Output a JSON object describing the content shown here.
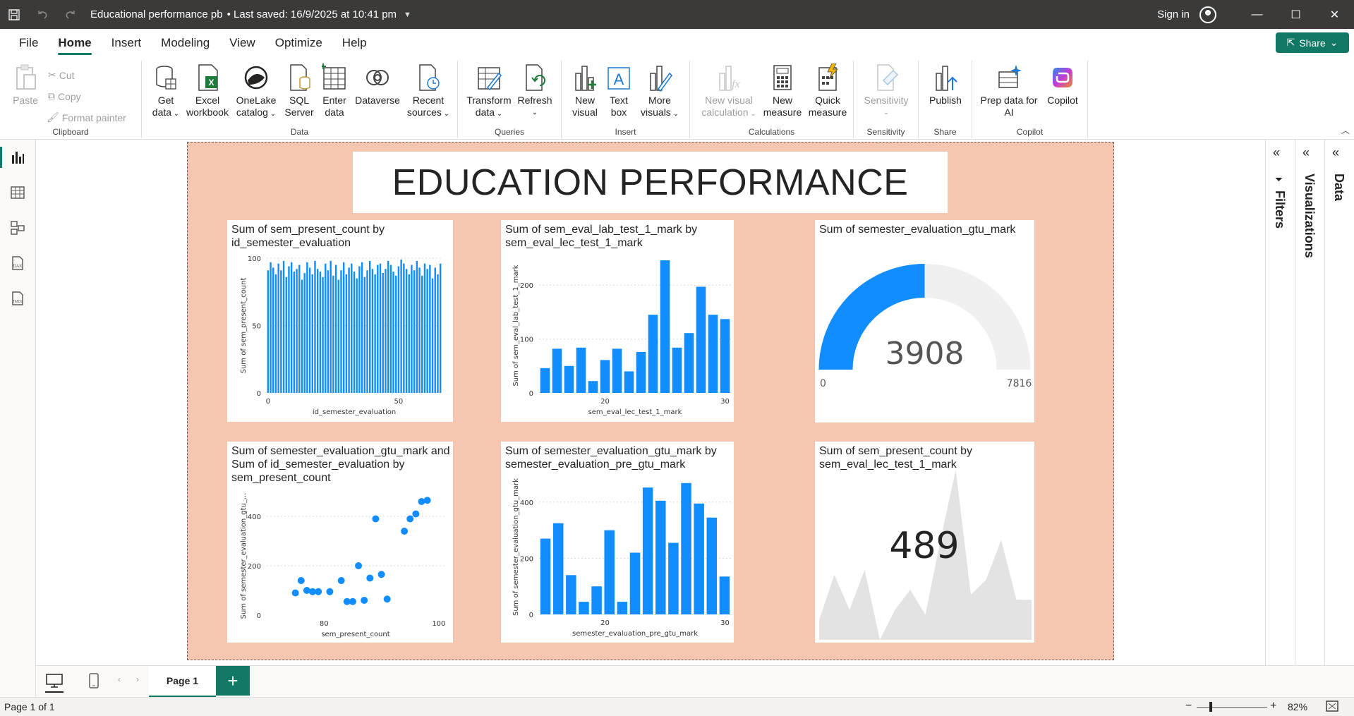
{
  "titlebar": {
    "title": "Educational performance pb",
    "saved": "• Last saved: 16/9/2025 at 10:41 pm",
    "signin": "Sign in"
  },
  "menu": {
    "items": [
      "File",
      "Home",
      "Insert",
      "Modeling",
      "View",
      "Optimize",
      "Help"
    ],
    "active": "Home",
    "share": "Share"
  },
  "ribbon": {
    "clipboard": {
      "label": "Clipboard",
      "paste": "Paste",
      "cut": "Cut",
      "copy": "Copy",
      "format_painter": "Format painter"
    },
    "data": {
      "label": "Data",
      "get_data": [
        "Get",
        "data"
      ],
      "excel": [
        "Excel",
        "workbook"
      ],
      "onelake": [
        "OneLake",
        "catalog"
      ],
      "sql": [
        "SQL",
        "Server"
      ],
      "enter": [
        "Enter",
        "data"
      ],
      "dataverse": [
        "Dataverse",
        ""
      ],
      "recent": [
        "Recent",
        "sources"
      ]
    },
    "queries": {
      "label": "Queries",
      "transform": [
        "Transform",
        "data"
      ],
      "refresh": [
        "Refresh",
        ""
      ]
    },
    "insert": {
      "label": "Insert",
      "new_visual": [
        "New",
        "visual"
      ],
      "text_box": [
        "Text",
        "box"
      ],
      "more_visuals": [
        "More",
        "visuals"
      ]
    },
    "calculations": {
      "label": "Calculations",
      "new_visual_calc": [
        "New visual",
        "calculation"
      ],
      "new_measure": [
        "New",
        "measure"
      ],
      "quick_measure": [
        "Quick",
        "measure"
      ]
    },
    "sensitivity": {
      "label": "Sensitivity",
      "btn": [
        "Sensitivity",
        ""
      ]
    },
    "share": {
      "label": "Share",
      "publish": [
        "Publish",
        ""
      ]
    },
    "copilot": {
      "label": "Copilot",
      "prep": [
        "Prep data for",
        "AI"
      ],
      "copilot": [
        "Copilot",
        ""
      ]
    }
  },
  "report": {
    "title": "EDUCATION PERFORMANCE"
  },
  "visuals": {
    "v1": {
      "title": "Sum of sem_present_count by id_semester_evaluation",
      "xlabel": "id_semester_evaluation",
      "ylabel": "Sum of sem_present_count"
    },
    "v2": {
      "title": "Sum of sem_eval_lab_test_1_mark by sem_eval_lec_test_1_mark",
      "xlabel": "sem_eval_lec_test_1_mark",
      "ylabel": "Sum of sem_eval_lab_test_1_mark"
    },
    "v3": {
      "title": "Sum of semester_evaluation_gtu_mark",
      "value": "3908",
      "min": "0",
      "max": "7816"
    },
    "v4": {
      "title": "Sum of semester_evaluation_gtu_mark and Sum of id_semester_evaluation by sem_present_count",
      "xlabel": "sem_present_count",
      "ylabel": "Sum of semester_evaluation_gtu_..."
    },
    "v5": {
      "title": "Sum of semester_evaluation_gtu_mark by semester_evaluation_pre_gtu_mark",
      "xlabel": "semester_evaluation_pre_gtu_mark",
      "ylabel": "Sum of semester_evaluation_gtu_mark"
    },
    "v6": {
      "title": "Sum of sem_present_count by sem_eval_lec_test_1_mark",
      "value": "489"
    }
  },
  "chart_data": [
    {
      "type": "bar",
      "title": "Sum of sem_present_count by id_semester_evaluation",
      "xlabel": "id_semester_evaluation",
      "ylabel": "Sum of sem_present_count",
      "xticks": [
        0,
        50
      ],
      "yticks": [
        0,
        50,
        100
      ],
      "ylim": [
        0,
        100
      ],
      "values": [
        91,
        97,
        93,
        88,
        96,
        91,
        98,
        86,
        94,
        97,
        90,
        92,
        95,
        84,
        89,
        97,
        93,
        88,
        98,
        92,
        90,
        86,
        96,
        91,
        98,
        87,
        95,
        84,
        91,
        97,
        88,
        93,
        96,
        90,
        85,
        94,
        97,
        86,
        91,
        98,
        92,
        88,
        95,
        96,
        89,
        92,
        98,
        95,
        90,
        87,
        94,
        99,
        96,
        92,
        88,
        95,
        91,
        98,
        93,
        87,
        96,
        92,
        95,
        85,
        93,
        88,
        96
      ]
    },
    {
      "type": "bar",
      "title": "Sum of sem_eval_lab_test_1_mark by sem_eval_lec_test_1_mark",
      "xlabel": "sem_eval_lec_test_1_mark",
      "ylabel": "Sum of sem_eval_lab_test_1_mark",
      "categories": [
        16,
        17,
        18,
        19,
        20,
        21,
        22,
        23,
        24,
        25,
        26,
        27,
        28,
        29,
        30
      ],
      "xticks": [
        20,
        30
      ],
      "yticks": [
        0,
        100,
        200
      ],
      "ylim": [
        0,
        250
      ],
      "values": [
        46,
        82,
        50,
        84,
        22,
        61,
        82,
        40,
        76,
        145,
        246,
        84,
        111,
        197,
        145,
        137
      ]
    },
    {
      "type": "gauge",
      "title": "Sum of semester_evaluation_gtu_mark",
      "value": 3908,
      "min": 0,
      "max": 7816
    },
    {
      "type": "scatter",
      "title": "Sum of semester_evaluation_gtu_mark and Sum of id_semester_evaluation by sem_present_count",
      "xlabel": "sem_present_count",
      "ylabel": "Sum of semester_evaluation_gtu_...",
      "xticks": [
        80,
        100
      ],
      "yticks": [
        0,
        200,
        400
      ],
      "xlim": [
        70,
        101
      ],
      "ylim": [
        0,
        480
      ],
      "points": [
        [
          75,
          90
        ],
        [
          76,
          140
        ],
        [
          77,
          100
        ],
        [
          78,
          95
        ],
        [
          79,
          95
        ],
        [
          81,
          95
        ],
        [
          83,
          140
        ],
        [
          84,
          55
        ],
        [
          85,
          55
        ],
        [
          86,
          200
        ],
        [
          87,
          60
        ],
        [
          88,
          150
        ],
        [
          89,
          390
        ],
        [
          90,
          165
        ],
        [
          91,
          65
        ],
        [
          94,
          340
        ],
        [
          95,
          390
        ],
        [
          96,
          410
        ],
        [
          97,
          460
        ],
        [
          98,
          465
        ]
      ]
    },
    {
      "type": "bar",
      "title": "Sum of semester_evaluation_gtu_mark by semester_evaluation_pre_gtu_mark",
      "xlabel": "semester_evaluation_pre_gtu_mark",
      "ylabel": "Sum of semester_evaluation_gtu_mark",
      "categories": [
        15,
        16,
        17,
        18,
        19,
        20,
        21,
        22,
        23,
        24,
        25,
        26,
        27,
        28,
        29,
        30
      ],
      "xticks": [
        20,
        30
      ],
      "yticks": [
        0,
        200,
        400
      ],
      "ylim": [
        0,
        480
      ],
      "values": [
        270,
        325,
        140,
        45,
        100,
        300,
        45,
        220,
        452,
        405,
        255,
        468,
        395,
        345,
        135
      ]
    },
    {
      "type": "area",
      "title": "Sum of sem_present_count by sem_eval_lec_test_1_mark",
      "card_value": 489,
      "values": [
        20,
        65,
        30,
        70,
        0,
        30,
        50,
        25,
        100,
        170,
        45,
        60,
        100,
        40,
        40
      ]
    }
  ]
}
